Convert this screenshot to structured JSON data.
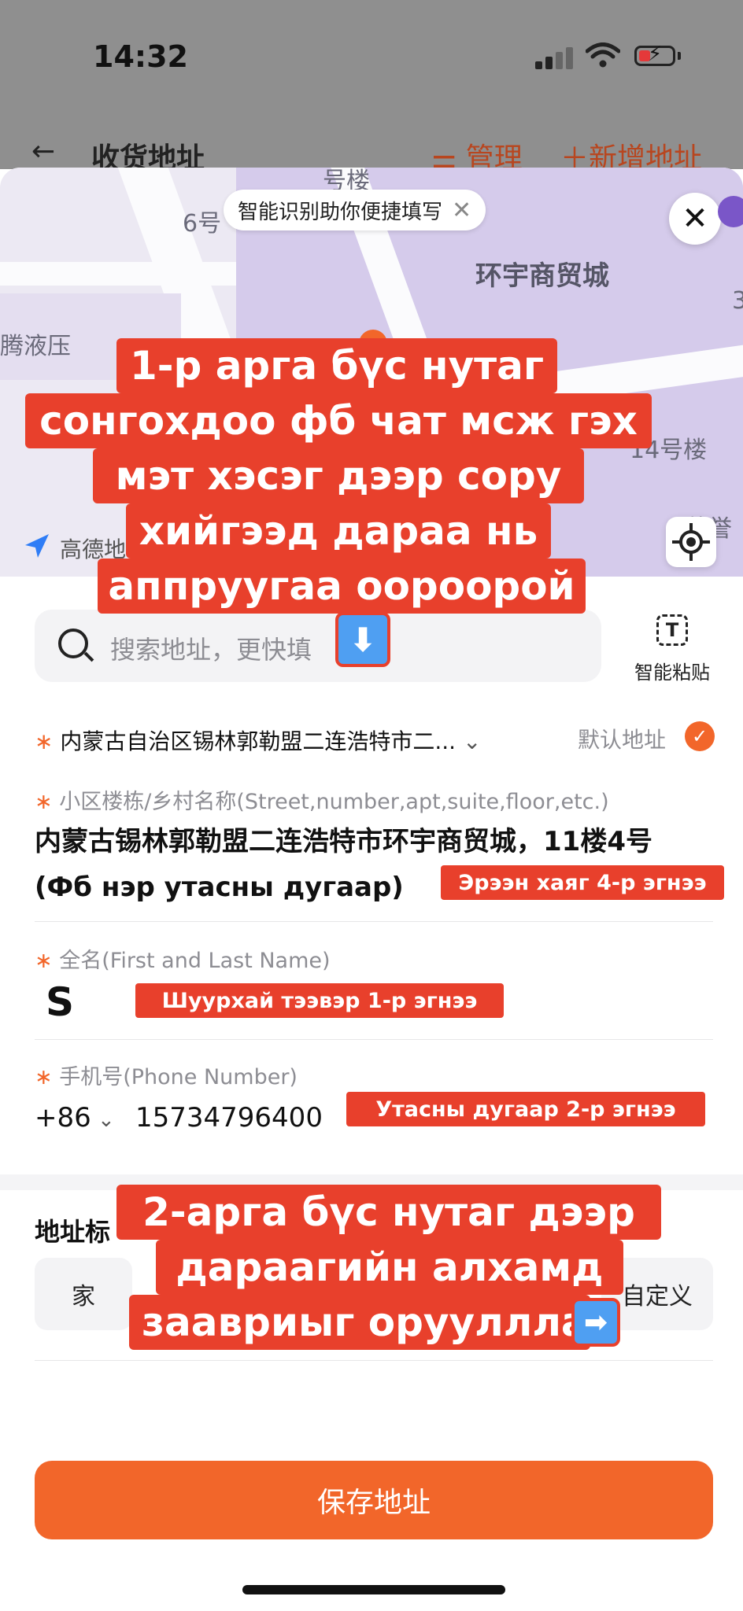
{
  "status_bar": {
    "time": "14:32"
  },
  "header": {
    "back_icon": "←",
    "title": "收货地址",
    "manage_label": "管理",
    "new_label": "新增地址"
  },
  "map": {
    "labels": [
      "6号",
      "环宇商贸城",
      "腾液压",
      "14号楼",
      "号楼",
      "3",
      "蒙誉"
    ],
    "smart_hint": "智能识别助你便捷填写",
    "provider": "高德地"
  },
  "search": {
    "placeholder": "搜索地址，更快填",
    "paste_icon": "T",
    "paste_label": "智能粘贴"
  },
  "form": {
    "region": "内蒙古自治区锡林郭勒盟二连浩特市二...",
    "default_label": "默认地址",
    "address_label": "小区楼栋/乡村名称(Street,number,apt,suite,floor,etc.)",
    "address_value": "内蒙古锡林郭勒盟二连浩特市环宇商贸城，11楼4号 (Фб нэр утасны дугаар)",
    "name_label": "全名(First and Last Name)",
    "name_value": "S",
    "phone_label": "手机号(Phone Number)",
    "country_code": "+86",
    "phone_value": "15734796400",
    "tag_title": "地址标",
    "tags": [
      "家",
      "自定义"
    ]
  },
  "save_button": "保存地址",
  "overlay": {
    "note1_lines": [
      "1-р арга бүс нутаг",
      "сонгохдоо фб чат мсж гэх",
      "мэт хэсэг дээр сору",
      "хийгээд дараа нь",
      "аппруугаа оороорой"
    ],
    "arrow_down": "⬇",
    "address_tag": "Эрээн хаяг 4-р эгнээ",
    "name_tag": "Шуурхай тээвэр 1-р эгнээ",
    "phone_tag": "Утасны дугаар 2-р эгнээ",
    "note2_lines": [
      "2-арга бүс нутаг дээр",
      "дараагийн алхамд",
      "заавриыг оруулллаа"
    ],
    "arrow_right": "➡"
  },
  "colors": {
    "accent": "#f2662a",
    "overlay_red": "#e8402c",
    "map_building": "#d5cbeb"
  }
}
